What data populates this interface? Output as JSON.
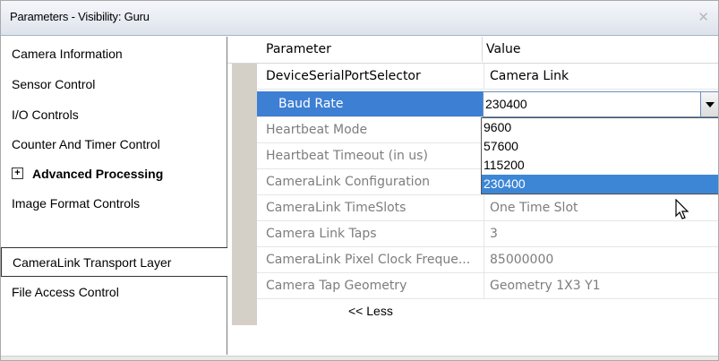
{
  "window": {
    "title": "Parameters - Visibility: Guru",
    "close_glyph": "✕"
  },
  "left_panel": {
    "items": [
      {
        "label": "Camera Information",
        "expandable": false,
        "selected": false
      },
      {
        "label": "Sensor Control",
        "expandable": false,
        "selected": false
      },
      {
        "label": "I/O Controls",
        "expandable": false,
        "selected": false
      },
      {
        "label": "Counter And Timer Control",
        "expandable": false,
        "selected": false
      },
      {
        "label": "Advanced Processing",
        "expandable": true,
        "selected": false,
        "expander": "⊞"
      },
      {
        "label": "Image Format Controls",
        "expandable": false,
        "selected": false
      },
      {
        "label": "CameraLink Transport Layer",
        "expandable": false,
        "selected": true
      },
      {
        "label": "File Access Control",
        "expandable": false,
        "selected": false
      }
    ]
  },
  "grid": {
    "header": {
      "parameter": "Parameter",
      "value": "Value"
    },
    "rows": [
      {
        "name": "DeviceSerialPortSelector",
        "value": "Camera Link",
        "enabled": true
      },
      {
        "name": "Baud Rate",
        "value": "230400",
        "enabled": true,
        "active": true
      },
      {
        "name": "Heartbeat Mode",
        "value": "",
        "enabled": false
      },
      {
        "name": "Heartbeat Timeout (in us)",
        "value": "",
        "enabled": false
      },
      {
        "name": "CameraLink Configuration",
        "value": "",
        "enabled": false
      },
      {
        "name": "CameraLink TimeSlots",
        "value": "One Time Slot",
        "enabled": false
      },
      {
        "name": "Camera Link Taps",
        "value": "3",
        "enabled": false
      },
      {
        "name": "CameraLink Pixel Clock Freque...",
        "value": "85000000",
        "enabled": false
      },
      {
        "name": "Camera Tap Geometry",
        "value": "Geometry 1X3 Y1",
        "enabled": false
      }
    ],
    "less_link": "<< Less"
  },
  "baud_dropdown": {
    "selected_value": "230400",
    "options": [
      "9600",
      "57600",
      "115200",
      "230400"
    ],
    "highlighted_index": 3
  },
  "colors": {
    "selection_blue": "#3d7fd3",
    "dropdown_highlight": "#3d86d6",
    "disabled_text": "#7d7d7d"
  }
}
